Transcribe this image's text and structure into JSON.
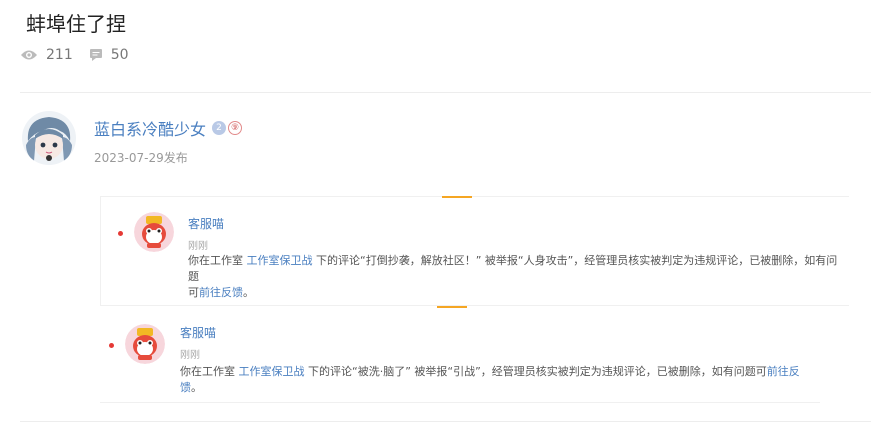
{
  "post": {
    "title": "蚌埠住了捏",
    "views": "211",
    "comments": "50"
  },
  "author": {
    "name": "蓝白系冷酷少女",
    "level_badge": "2",
    "extra_badge": "⑨",
    "date": "2023-07-29发布"
  },
  "notices": [
    {
      "bot_name": "客服喵",
      "time": "刚刚",
      "text_pre": "你在工作室",
      "studio_link": "工作室保卫战",
      "text_mid_line1": "下的评论“打倒抄袭，解放社区！” 被举报“人身攻击”，经管理员核实被判定为违规评论，已被删除，如有问题",
      "text_line2_pre": "可",
      "feedback_link": "前往反馈",
      "text_end": "。"
    },
    {
      "bot_name": "客服喵",
      "time": "刚刚",
      "text_pre": "你在工作室",
      "studio_link": "工作室保卫战",
      "text_mid_line1": "下的评论“被洗·脑了” 被举报“引战”，经管理员核实被判定为违规评论，已被删除，如有问题可",
      "feedback_link": "前往反馈",
      "text_end": "。"
    }
  ],
  "colors": {
    "link": "#4a7fc0",
    "accent": "#f5a623",
    "unread_dot": "#e53935"
  },
  "icons": [
    "eye-icon",
    "comment-icon",
    "avatar-icon",
    "bot-avatar-icon"
  ]
}
